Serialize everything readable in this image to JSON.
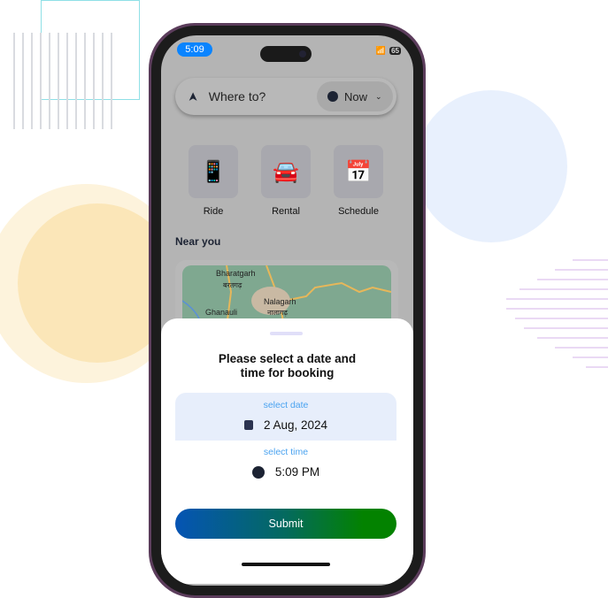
{
  "status_bar": {
    "time": "5:09",
    "battery": "65"
  },
  "search": {
    "placeholder": "Where to?",
    "time_selector": "Now"
  },
  "services": [
    {
      "label": "Ride",
      "icon": "phone-car-icon"
    },
    {
      "label": "Rental",
      "icon": "rent-car-icon"
    },
    {
      "label": "Schedule",
      "icon": "calendar-car-icon"
    }
  ],
  "near_you": {
    "title": "Near you",
    "map_labels": [
      "Bharatgarh",
      "बरतगढ़",
      "Nalagarh",
      "नालागढ़",
      "Ghanauli"
    ]
  },
  "sheet": {
    "title_line1": "Please select a date and",
    "title_line2": "time for booking",
    "date_label": "select date",
    "date_value": "2 Aug, 2024",
    "time_label": "select time",
    "time_value": "5:09 PM",
    "submit": "Submit"
  },
  "colors": {
    "accent": "#4aa3f0",
    "gradient_start": "#0554b4",
    "gradient_end": "#038200"
  }
}
